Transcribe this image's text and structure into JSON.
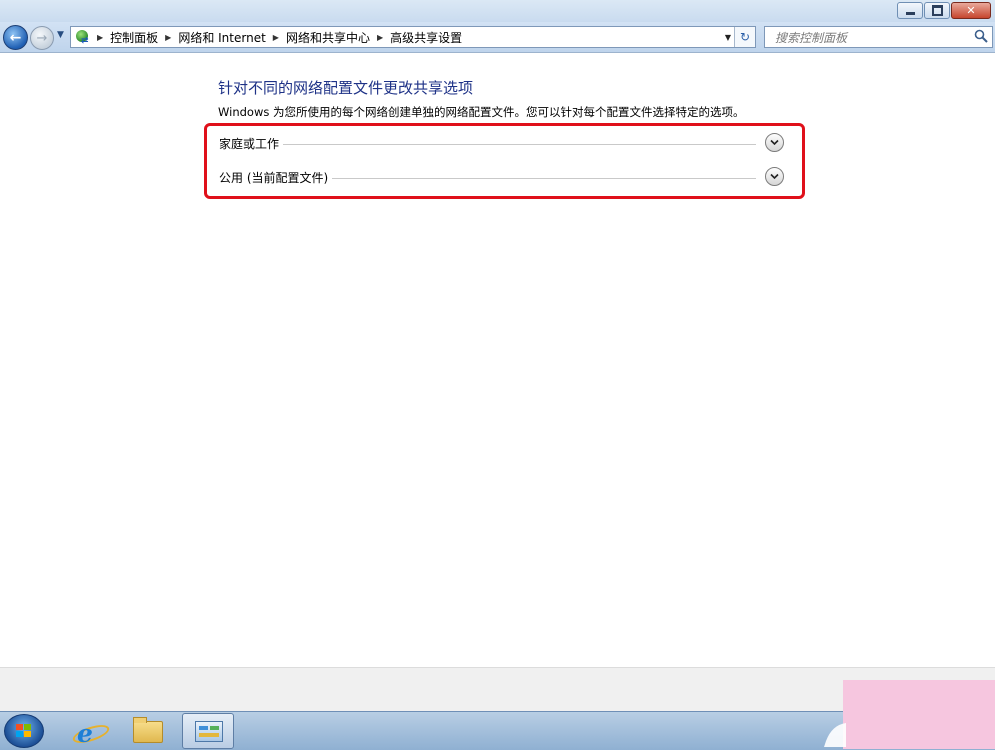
{
  "window": {
    "buttons": {
      "minimize": "minimize",
      "restore": "restore",
      "close": "close"
    }
  },
  "nav": {
    "breadcrumbs": [
      "控制面板",
      "网络和 Internet",
      "网络和共享中心",
      "高级共享设置"
    ]
  },
  "search": {
    "placeholder": "搜索控制面板"
  },
  "content": {
    "heading": "针对不同的网络配置文件更改共享选项",
    "description": "Windows 为您所使用的每个网络创建单独的网络配置文件。您可以针对每个配置文件选择特定的选项。",
    "profiles": [
      {
        "label": "家庭或工作"
      },
      {
        "label": "公用 (当前配置文件)"
      }
    ]
  },
  "colors": {
    "heading": "#1e3287",
    "highlight_border": "#e0101a",
    "watermark_pink": "#f6c6df"
  },
  "taskbar": {
    "items": [
      "start-button",
      "internet-explorer",
      "windows-explorer",
      "control-panel"
    ]
  }
}
